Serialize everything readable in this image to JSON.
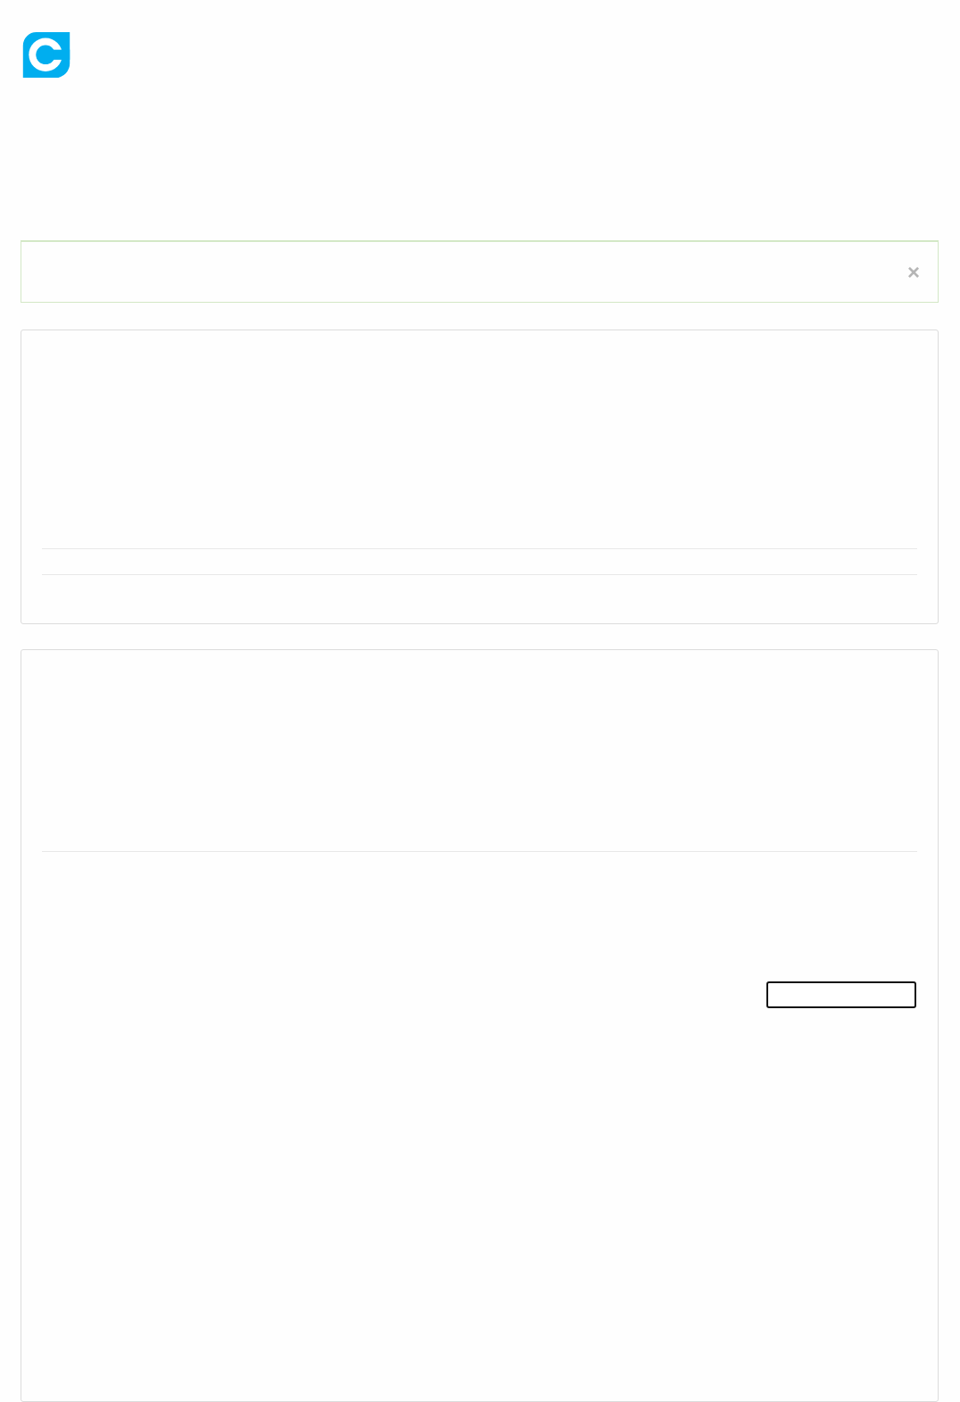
{
  "alert": {
    "close_label": "×"
  }
}
